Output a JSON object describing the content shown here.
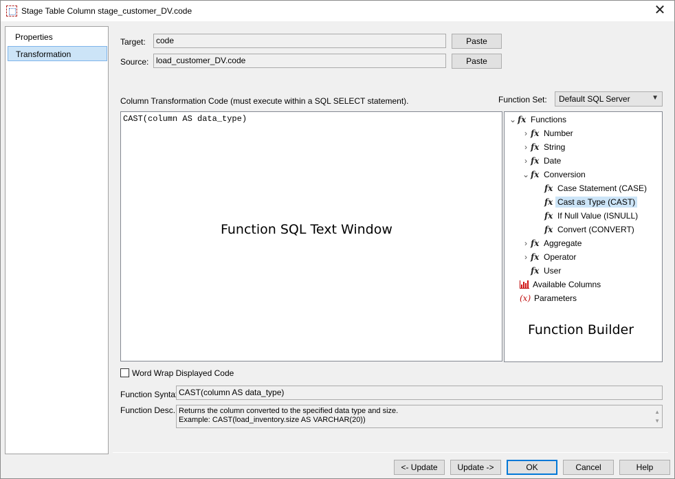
{
  "window": {
    "title": "Stage Table Column stage_customer_DV.code",
    "close": "✕"
  },
  "nav": {
    "items": [
      {
        "label": "Properties",
        "selected": false
      },
      {
        "label": "Transformation",
        "selected": true
      }
    ]
  },
  "target": {
    "label": "Target:",
    "value": "code",
    "paste": "Paste"
  },
  "source": {
    "label": "Source:",
    "value": "load_customer_DV.code",
    "paste": "Paste"
  },
  "code": {
    "header": "Column Transformation Code (must execute within a SQL SELECT statement).",
    "text": "CAST(column AS data_type)",
    "overlay": "Function SQL Text Window"
  },
  "function_set": {
    "label": "Function Set:",
    "value": "Default SQL Server"
  },
  "tree": {
    "overlay": "Function Builder",
    "functions": "Functions",
    "number": "Number",
    "string": "String",
    "date": "Date",
    "conversion": "Conversion",
    "case_statement": "Case Statement (CASE)",
    "cast_as_type": "Cast as Type (CAST)",
    "if_null": "If Null Value (ISNULL)",
    "convert": "Convert (CONVERT)",
    "aggregate": "Aggregate",
    "operator": "Operator",
    "user": "User",
    "available_columns": "Available Columns",
    "parameters": "Parameters"
  },
  "word_wrap": {
    "label": "Word Wrap Displayed Code",
    "checked": false
  },
  "syntax": {
    "label": "Function Syntax:",
    "value": "CAST(column AS data_type)"
  },
  "desc": {
    "label": "Function Desc.:",
    "line1": "Returns the column converted to the specified data type and size.",
    "line2": "Example: CAST(load_inventory.size AS VARCHAR(20))"
  },
  "buttons": {
    "update_back": "<- Update",
    "update_fwd": "Update ->",
    "ok": "OK",
    "cancel": "Cancel",
    "help": "Help"
  }
}
